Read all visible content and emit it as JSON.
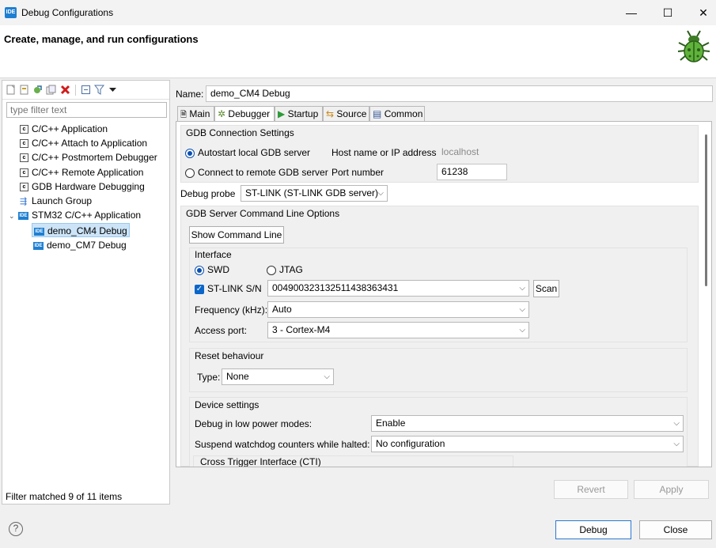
{
  "window": {
    "title": "Debug Configurations",
    "app_icon": "IDE",
    "min": "—",
    "max": "☐",
    "close": "✕"
  },
  "header": {
    "title": "Create, manage, and run configurations"
  },
  "left": {
    "filter_placeholder": "type filter text",
    "tree": [
      {
        "label": "C/C++ Application",
        "icon": "c-icon"
      },
      {
        "label": "C/C++ Attach to Application",
        "icon": "c-icon"
      },
      {
        "label": "C/C++ Postmortem Debugger",
        "icon": "c-icon"
      },
      {
        "label": "C/C++ Remote Application",
        "icon": "c-icon"
      },
      {
        "label": "GDB Hardware Debugging",
        "icon": "c-icon"
      },
      {
        "label": "Launch Group",
        "icon": "launch-group-icon"
      },
      {
        "label": "STM32 C/C++ Application",
        "icon": "ide-icon",
        "expanded": true
      },
      {
        "label": "demo_CM4 Debug",
        "icon": "ide-icon",
        "selected": true
      },
      {
        "label": "demo_CM7 Debug",
        "icon": "ide-icon"
      }
    ],
    "status": "Filter matched 9 of 11 items"
  },
  "config": {
    "name_label": "Name:",
    "name_value": "demo_CM4 Debug",
    "tabs": [
      "Main",
      "Debugger",
      "Startup",
      "Source",
      "Common"
    ],
    "active_tab": "Debugger",
    "gdb_connection": {
      "title": "GDB Connection Settings",
      "autostart": "Autostart local GDB server",
      "connect_remote": "Connect to remote GDB server",
      "host_label": "Host name or IP address",
      "host_value": "localhost",
      "port_label": "Port number",
      "port_value": "61238"
    },
    "probe_label": "Debug probe",
    "probe_value": "ST-LINK (ST-LINK GDB server)",
    "server_options": {
      "title": "GDB Server Command Line Options",
      "show_cmd": "Show Command Line",
      "interface_title": "Interface",
      "swd": "SWD",
      "jtag": "JTAG",
      "stlink_sn_label": "ST-LINK S/N",
      "stlink_sn_value": "004900323132511438363431",
      "scan": "Scan",
      "freq_label": "Frequency (kHz):",
      "freq_value": "Auto",
      "access_label": "Access port:",
      "access_value": "3 - Cortex-M4"
    },
    "reset": {
      "title": "Reset behaviour",
      "type_label": "Type:",
      "type_value": "None"
    },
    "device": {
      "title": "Device settings",
      "low_power_label": "Debug in low power modes:",
      "low_power_value": "Enable",
      "watchdog_label": "Suspend watchdog counters while halted:",
      "watchdog_value": "No configuration",
      "cti_title": "Cross Trigger Interface (CTI)"
    }
  },
  "footer": {
    "revert": "Revert",
    "apply": "Apply",
    "debug": "Debug",
    "close": "Close",
    "help": "?"
  },
  "colors": {
    "accent": "#1e7fd2",
    "selection": "#cce4f7"
  }
}
